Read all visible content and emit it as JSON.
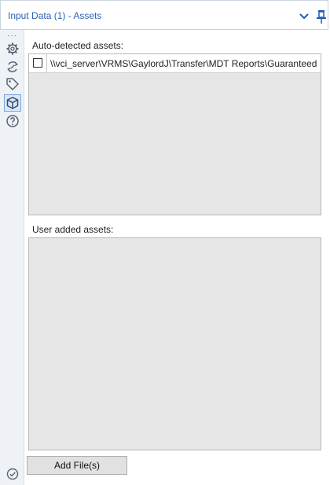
{
  "window": {
    "title": "Input Data (1) - Assets"
  },
  "rail": {
    "icons": [
      "ellipsis-icon",
      "gear-icon",
      "refresh-icon",
      "tag-icon",
      "cube-icon",
      "help-icon",
      "check-circle-icon"
    ],
    "selected": "cube-icon"
  },
  "auto_detected": {
    "label": "Auto-detected assets:",
    "rows": [
      {
        "checked": false,
        "path": "\\\\vci_server\\VRMS\\GaylordJ\\Transfer\\MDT Reports\\Guaranteed Sp..."
      }
    ]
  },
  "user_added": {
    "label": "User added assets:"
  },
  "actions": {
    "add_files_label": "Add File(s)"
  },
  "colors": {
    "title": "#2b63b8",
    "accent": "#1f5bb8",
    "panel_bg": "#e6e6e6",
    "rail_bg": "#eef2f7"
  }
}
